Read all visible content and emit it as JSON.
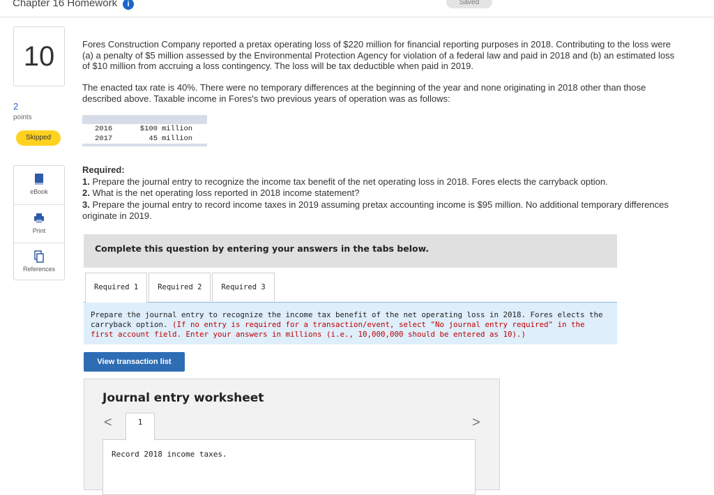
{
  "header": {
    "chapter_title": "Chapter 16 Homework",
    "info_badge": "i",
    "saved_label": "Saved"
  },
  "question": {
    "number": "10",
    "points_value": "2",
    "points_label": "points",
    "status": "Skipped"
  },
  "tools": [
    {
      "label": "eBook",
      "icon": "book-icon"
    },
    {
      "label": "Print",
      "icon": "print-icon"
    },
    {
      "label": "References",
      "icon": "references-icon"
    }
  ],
  "problem": {
    "paragraph1": "Fores Construction Company reported a pretax operating loss of $220 million for financial reporting purposes in 2018. Contributing to the loss were (a) a penalty of $5 million assessed by the Environmental Protection Agency for violation of a federal law and paid in 2018 and (b) an estimated loss of $10 million from accruing a loss contingency. The loss will be tax deductible when paid in 2019.",
    "paragraph2": "The enacted tax rate is 40%. There were no temporary differences at the beginning of the year and none originating in 2018 other than those described above. Taxable income in Fores's two previous years of operation was as follows:",
    "table": [
      {
        "year": "2016",
        "amount": "$100",
        "unit": "million"
      },
      {
        "year": "2017",
        "amount": "45",
        "unit": "million"
      }
    ]
  },
  "required": {
    "heading": "Required:",
    "items": [
      {
        "num": "1.",
        "text": " Prepare the journal entry to recognize the income tax benefit of the net operating loss in 2018. Fores elects the carryback option."
      },
      {
        "num": "2.",
        "text": " What is the net operating loss reported in 2018 income statement?"
      },
      {
        "num": "3.",
        "text": " Prepare the journal entry to record income taxes in 2019 assuming pretax accounting income is $95 million. No additional temporary differences originate in 2019."
      }
    ]
  },
  "complete_prompt": "Complete this question by entering your answers in the tabs below.",
  "tabs": [
    {
      "label": "Required 1",
      "active": true
    },
    {
      "label": "Required 2",
      "active": false
    },
    {
      "label": "Required 3",
      "active": false
    }
  ],
  "instructions": {
    "main": "Prepare the journal entry to recognize the income tax benefit of the net operating loss in 2018. Fores elects the carryback option.",
    "note": "(If no entry is required for a transaction/event, select \"No journal entry required\" in the first account field. Enter your answers in millions (i.e., 10,000,000 should be entered as 10).)"
  },
  "view_transaction_button": "View transaction list",
  "worksheet": {
    "title": "Journal entry worksheet",
    "prev": "<",
    "next": ">",
    "page": "1",
    "entry_description": "Record 2018 income taxes."
  }
}
